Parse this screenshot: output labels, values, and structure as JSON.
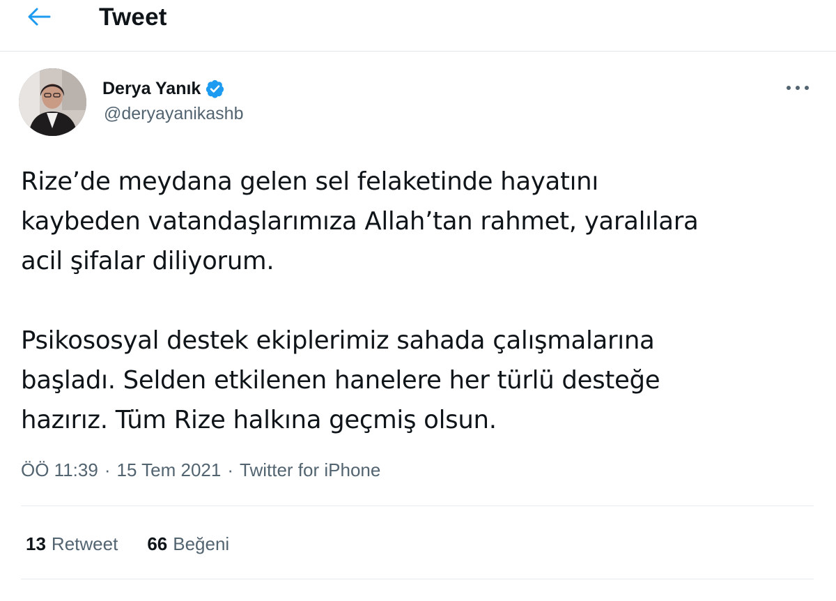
{
  "header": {
    "title": "Tweet",
    "back_icon": "arrow-left-icon"
  },
  "author": {
    "name": "Derya Yanık",
    "handle": "@deryayanikashb",
    "verified_icon": "verified-badge-icon",
    "more_icon": "more-horizontal-icon"
  },
  "tweet": {
    "paragraph1": [
      "Rize’de meydana gelen sel felaketinde hayatını",
      "kaybeden vatandaşlarımıza Allah’tan rahmet, yaralılara",
      "acil şifalar diliyorum."
    ],
    "paragraph2": [
      "Psikososyal destek ekiplerimiz sahada çalışmalarına",
      "başladı. Selden etkilenen hanelere her türlü desteğe",
      "hazırız. Tüm Rize halkına geçmiş olsun."
    ]
  },
  "meta": {
    "time": "ÖÖ 11:39",
    "separator": "·",
    "date": "15 Tem 2021",
    "source": "Twitter for iPhone"
  },
  "stats": {
    "retweets_count": "13",
    "retweets_label": "Retweet",
    "likes_count": "66",
    "likes_label": "Beğeni"
  },
  "colors": {
    "accent": "#1d9bf0",
    "text_primary": "#0f1419",
    "text_secondary": "#536471",
    "divider": "#e6ecf0"
  }
}
